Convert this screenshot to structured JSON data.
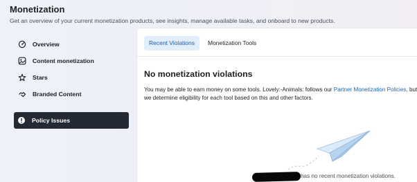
{
  "header": {
    "title": "Monetization",
    "subtitle": "Get an overview of your current monetization products, see insights, manage available tasks, and onboard to new products."
  },
  "sidebar": {
    "items": [
      {
        "label": "Overview",
        "icon": "gauge-icon"
      },
      {
        "label": "Content monetization",
        "icon": "content-icon"
      },
      {
        "label": "Stars",
        "icon": "stars-icon"
      },
      {
        "label": "Branded Content",
        "icon": "handshake-icon"
      },
      {
        "label": "Policy Issues",
        "icon": "alert-icon",
        "active": true
      }
    ]
  },
  "tabs": [
    {
      "label": "Recent Violations",
      "active": true
    },
    {
      "label": "Monetization Tools",
      "active": false
    }
  ],
  "main": {
    "heading": "No monetization violations",
    "para_part1": "You may be able to earn money on some tools. Lovely:-Animals: follows our ",
    "para_link": "Partner Monetization Policies,",
    "para_part2": " but we determine eligibility for each tool based on this and other factors.",
    "status_text": "has no recent monetization violations."
  },
  "colors": {
    "accent": "#1a66c7",
    "active_nav_bg": "#232a33",
    "active_tab_bg": "#e3eefb"
  }
}
